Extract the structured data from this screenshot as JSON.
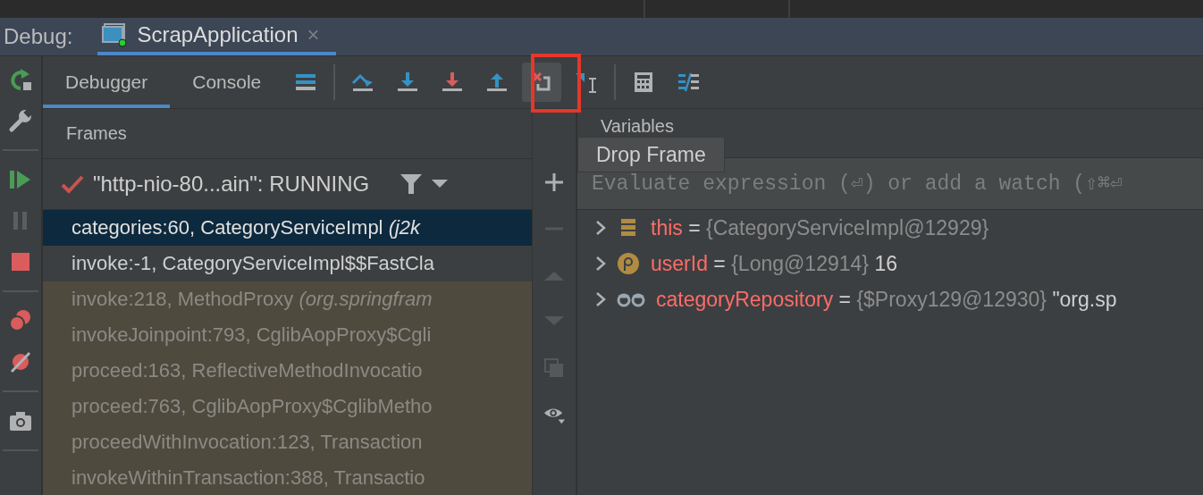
{
  "debug_bar": {
    "label": "Debug:",
    "tab": {
      "title": "ScrapApplication",
      "close": "×",
      "selected": true
    }
  },
  "tabs": [
    {
      "label": "Debugger",
      "selected": true
    },
    {
      "label": "Console",
      "selected": false
    }
  ],
  "toolbar": [
    {
      "kind": "layout",
      "highlighted": false
    },
    {
      "kind": "step_over",
      "highlighted": false
    },
    {
      "kind": "step_into",
      "highlighted": false
    },
    {
      "kind": "force_step_into",
      "highlighted": false
    },
    {
      "kind": "step_out",
      "highlighted": false
    },
    {
      "kind": "drop_frame",
      "highlighted": true
    },
    {
      "kind": "run_to_cursor",
      "highlighted": false
    },
    {
      "kind": "evaluate",
      "highlighted": false
    },
    {
      "kind": "trace",
      "highlighted": false
    }
  ],
  "frames": {
    "title": "Frames",
    "thread": {
      "name": "\"http-nio-80...ain\": RUNNING"
    },
    "rows": [
      {
        "method": "categories:60, CategoryServiceImpl ",
        "location": "(j2k",
        "selected": true,
        "library": false
      },
      {
        "method": "invoke:-1, CategoryServiceImpl$$FastCla",
        "selected": false,
        "library": false
      },
      {
        "method": "invoke:218, MethodProxy ",
        "location": "(org.springfram",
        "selected": false,
        "library": true
      },
      {
        "method": "invokeJoinpoint:793, CglibAopProxy$Cgli",
        "selected": false,
        "library": true
      },
      {
        "method": "proceed:163, ReflectiveMethodInvocatio",
        "selected": false,
        "library": true
      },
      {
        "method": "proceed:763, CglibAopProxy$CglibMetho",
        "selected": false,
        "library": true
      },
      {
        "method": "proceedWithInvocation:123, Transaction",
        "selected": false,
        "library": true
      },
      {
        "method": "invokeWithinTransaction:388, Transactio",
        "selected": false,
        "library": true
      }
    ]
  },
  "variables": {
    "title": "Variables",
    "evaluate": {
      "placeholder": "Evaluate expression (⏎) or add a watch (⇧⌘⏎"
    },
    "items": [
      {
        "kind": "field",
        "name": "this",
        "eq": "=",
        "value": "{CategoryServiceImpl@12929}"
      },
      {
        "kind": "param",
        "name": "userId",
        "eq": "=",
        "value": "{Long@12914}",
        "extra": "16"
      },
      {
        "kind": "watch",
        "name": "categoryRepository",
        "eq": "=",
        "value": "{$Proxy129@12930}",
        "extra": "\"org.sp"
      }
    ]
  },
  "tooltip": "Drop Frame"
}
